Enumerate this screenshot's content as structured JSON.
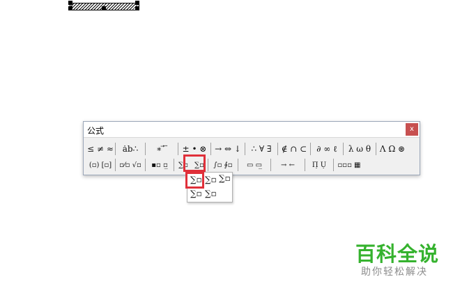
{
  "window": {
    "title": "公式",
    "close_label": "x"
  },
  "toolbar": {
    "row1": [
      {
        "label": "≤ ≠ ≈",
        "icon": "relational-symbols-icon"
      },
      {
        "label": "ȧb∴",
        "icon": "spaces-ellipses-icon"
      },
      {
        "label": "∗ ⃗ ⃛",
        "icon": "embellishments-icon"
      },
      {
        "label": "± • ⊗",
        "icon": "operator-symbols-icon"
      },
      {
        "label": "→ ⇔ ↓",
        "icon": "arrow-symbols-icon"
      },
      {
        "label": "∴ ∀ ∃",
        "icon": "logical-symbols-icon"
      },
      {
        "label": "∉ ∩ ⊂",
        "icon": "set-theory-symbols-icon"
      },
      {
        "label": "∂ ∞ ℓ",
        "icon": "misc-symbols-icon"
      },
      {
        "label": "λ ω θ",
        "icon": "greek-lowercase-icon"
      },
      {
        "label": "Λ Ω ⊛",
        "icon": "greek-uppercase-icon"
      }
    ],
    "row2": [
      {
        "label": "(▫) [▫]",
        "icon": "fence-templates-icon"
      },
      {
        "label": "▫⁄▫ √▫",
        "icon": "fraction-radical-templates-icon"
      },
      {
        "label": "▪▫ ▫̲",
        "icon": "subscript-superscript-templates-icon"
      },
      {
        "label": "∑▫",
        "icon": "summation-templates-icon"
      },
      {
        "label": "∑▫",
        "icon": "summation-templates-alt-icon"
      },
      {
        "label": "∫▫ ∮▫",
        "icon": "integral-templates-icon"
      },
      {
        "label": "▭ ▭̲",
        "icon": "underbar-overbar-templates-icon"
      },
      {
        "label": "→ ←",
        "icon": "labeled-arrow-templates-icon"
      },
      {
        "label": "Π̣ Ụ",
        "icon": "products-set-theory-templates-icon"
      },
      {
        "label": "▫▫▫ ▦",
        "icon": "matrix-templates-icon"
      }
    ]
  },
  "palette": {
    "items": [
      "∑▫",
      "∑▫",
      "∑̣▫",
      "∑▫",
      "∑▫"
    ]
  },
  "watermark": {
    "main": "百科全说",
    "sub": "助你轻松解决"
  },
  "colors": {
    "highlight": "#e0303a",
    "close": "#c75050",
    "watermark_green": "#35b22e"
  }
}
